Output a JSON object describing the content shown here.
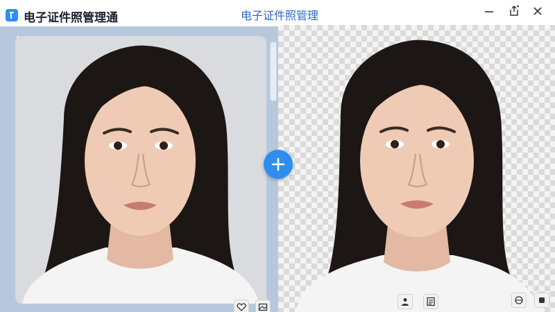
{
  "window": {
    "app_title": "电子证件照管理通",
    "center_title": "电子证件照管理"
  },
  "icons": {
    "app": "app-logo-icon",
    "minimize": "minimize-icon",
    "share": "share-icon",
    "close": "close-icon",
    "add": "plus-icon",
    "favorite": "heart-icon",
    "image": "image-icon",
    "person": "person-icon",
    "id_card": "id-card-icon",
    "rotate": "rotate-icon",
    "crop": "crop-icon"
  },
  "colors": {
    "accent": "#2f8df0",
    "title_blue": "#2a66c8",
    "left_frame": "#b7c8dd"
  }
}
